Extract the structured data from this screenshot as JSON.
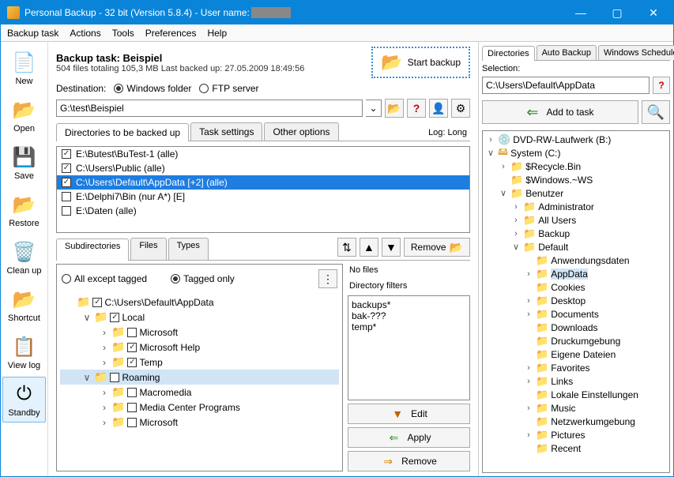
{
  "titlebar": {
    "title": "Personal Backup - 32 bit (Version 5.8.4) - User name:"
  },
  "menu": [
    "Backup task",
    "Actions",
    "Tools",
    "Preferences",
    "Help"
  ],
  "sidebar": [
    {
      "label": "New",
      "icon": "📄"
    },
    {
      "label": "Open",
      "icon": "📂"
    },
    {
      "label": "Save",
      "icon": "💾"
    },
    {
      "label": "Restore",
      "icon": "📂"
    },
    {
      "label": "Clean up",
      "icon": "🗑️"
    },
    {
      "label": "Shortcut",
      "icon": "📂"
    },
    {
      "label": "View log",
      "icon": "📋"
    },
    {
      "label": "Standby",
      "icon": "⏻",
      "active": true
    }
  ],
  "task": {
    "heading": "Backup task: Beispiel",
    "info": "504 files totaling 105,3 MB   Last backed up:  27.05.2009 18:49:56",
    "dest_label": "Destination:",
    "dest_windows": "Windows folder",
    "dest_ftp": "FTP server",
    "start_label": "Start backup",
    "path": "G:\\test\\Beispiel"
  },
  "tabs": {
    "dirs": "Directories to be backed up",
    "task": "Task settings",
    "other": "Other options",
    "log": "Log: Long"
  },
  "dirlist": [
    {
      "checked": true,
      "text": "E:\\Butest\\BuTest-1 (alle)"
    },
    {
      "checked": true,
      "text": "C:\\Users\\Public (alle)"
    },
    {
      "checked": true,
      "text": "C:\\Users\\Default\\AppData [+2] (alle)",
      "sel": true
    },
    {
      "checked": false,
      "text": "E:\\Delphi7\\Bin (nur A*) [E]"
    },
    {
      "checked": false,
      "text": "E:\\Daten (alle)"
    }
  ],
  "subtabs": {
    "sub": "Subdirectories",
    "files": "Files",
    "types": "Types",
    "remove": "Remove"
  },
  "subradio": {
    "all_except": "All except tagged",
    "tagged_only": "Tagged only"
  },
  "subtree": [
    {
      "indent": 0,
      "exp": "",
      "chk": true,
      "text": "C:\\Users\\Default\\AppData"
    },
    {
      "indent": 1,
      "exp": "∨",
      "chk": true,
      "text": "Local"
    },
    {
      "indent": 2,
      "exp": "›",
      "chk": false,
      "text": "Microsoft"
    },
    {
      "indent": 2,
      "exp": "›",
      "chk": true,
      "text": "Microsoft Help"
    },
    {
      "indent": 2,
      "exp": "›",
      "chk": true,
      "text": "Temp"
    },
    {
      "indent": 1,
      "exp": "∨",
      "chk": false,
      "text": "Roaming",
      "sel": true
    },
    {
      "indent": 2,
      "exp": "›",
      "chk": false,
      "text": "Macromedia"
    },
    {
      "indent": 2,
      "exp": "›",
      "chk": false,
      "text": "Media Center Programs"
    },
    {
      "indent": 2,
      "exp": "›",
      "chk": false,
      "text": "Microsoft"
    }
  ],
  "filters": {
    "nofiles": "No files",
    "label": "Directory filters",
    "items": [
      "backups*",
      "bak-???",
      "temp*"
    ],
    "edit": "Edit",
    "apply": "Apply",
    "remove": "Remove"
  },
  "right": {
    "tabs": [
      "Directories",
      "Auto Backup",
      "Windows Scheduler"
    ],
    "sel_label": "Selection:",
    "sel_value": "C:\\Users\\Default\\AppData",
    "add": "Add to task"
  },
  "dirtree": [
    {
      "indent": 0,
      "exp": "›",
      "icon": "💿",
      "text": "DVD-RW-Laufwerk (B:)"
    },
    {
      "indent": 0,
      "exp": "∨",
      "icon": "🖴",
      "text": "System (C:)"
    },
    {
      "indent": 1,
      "exp": "›",
      "icon": "📁",
      "text": "$Recycle.Bin"
    },
    {
      "indent": 1,
      "exp": "",
      "icon": "📁",
      "text": "$Windows.~WS"
    },
    {
      "indent": 1,
      "exp": "∨",
      "icon": "📁",
      "text": "Benutzer"
    },
    {
      "indent": 2,
      "exp": "›",
      "icon": "📁",
      "text": "Administrator"
    },
    {
      "indent": 2,
      "exp": "›",
      "icon": "📁",
      "text": "All Users"
    },
    {
      "indent": 2,
      "exp": "›",
      "icon": "📁",
      "text": "Backup"
    },
    {
      "indent": 2,
      "exp": "∨",
      "icon": "📁",
      "text": "Default"
    },
    {
      "indent": 3,
      "exp": "",
      "icon": "📁",
      "text": "Anwendungsdaten"
    },
    {
      "indent": 3,
      "exp": "›",
      "icon": "📁",
      "text": "AppData",
      "sel": true
    },
    {
      "indent": 3,
      "exp": "",
      "icon": "📁",
      "text": "Cookies"
    },
    {
      "indent": 3,
      "exp": "›",
      "icon": "📁",
      "text": "Desktop"
    },
    {
      "indent": 3,
      "exp": "›",
      "icon": "📁",
      "text": "Documents"
    },
    {
      "indent": 3,
      "exp": "",
      "icon": "📁",
      "text": "Downloads"
    },
    {
      "indent": 3,
      "exp": "",
      "icon": "📁",
      "text": "Druckumgebung"
    },
    {
      "indent": 3,
      "exp": "",
      "icon": "📁",
      "text": "Eigene Dateien"
    },
    {
      "indent": 3,
      "exp": "›",
      "icon": "📁",
      "text": "Favorites"
    },
    {
      "indent": 3,
      "exp": "›",
      "icon": "📁",
      "text": "Links"
    },
    {
      "indent": 3,
      "exp": "",
      "icon": "📁",
      "text": "Lokale Einstellungen"
    },
    {
      "indent": 3,
      "exp": "›",
      "icon": "📁",
      "text": "Music"
    },
    {
      "indent": 3,
      "exp": "",
      "icon": "📁",
      "text": "Netzwerkumgebung"
    },
    {
      "indent": 3,
      "exp": "›",
      "icon": "📁",
      "text": "Pictures"
    },
    {
      "indent": 3,
      "exp": "",
      "icon": "📁",
      "text": "Recent"
    }
  ]
}
